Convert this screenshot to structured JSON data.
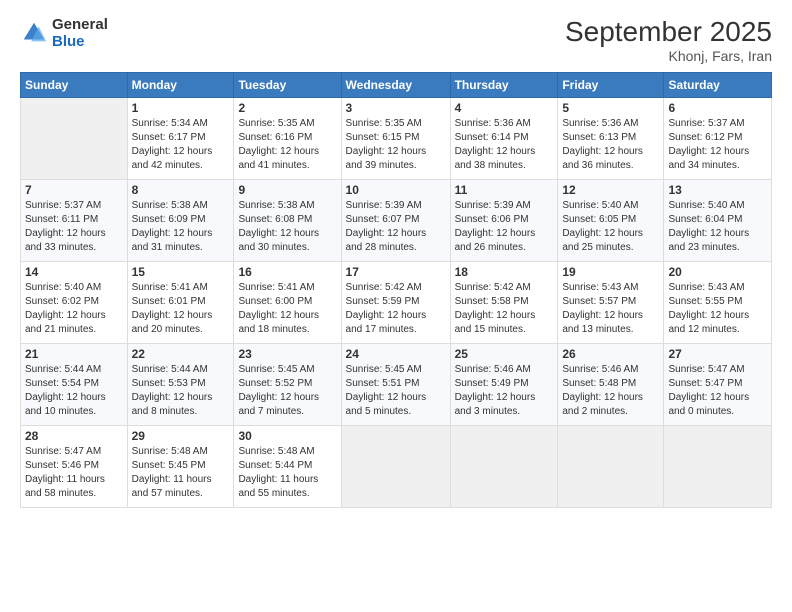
{
  "logo": {
    "general": "General",
    "blue": "Blue"
  },
  "header": {
    "month_year": "September 2025",
    "location": "Khonj, Fars, Iran"
  },
  "days_of_week": [
    "Sunday",
    "Monday",
    "Tuesday",
    "Wednesday",
    "Thursday",
    "Friday",
    "Saturday"
  ],
  "weeks": [
    [
      {
        "day": "",
        "info": ""
      },
      {
        "day": "1",
        "info": "Sunrise: 5:34 AM\nSunset: 6:17 PM\nDaylight: 12 hours\nand 42 minutes."
      },
      {
        "day": "2",
        "info": "Sunrise: 5:35 AM\nSunset: 6:16 PM\nDaylight: 12 hours\nand 41 minutes."
      },
      {
        "day": "3",
        "info": "Sunrise: 5:35 AM\nSunset: 6:15 PM\nDaylight: 12 hours\nand 39 minutes."
      },
      {
        "day": "4",
        "info": "Sunrise: 5:36 AM\nSunset: 6:14 PM\nDaylight: 12 hours\nand 38 minutes."
      },
      {
        "day": "5",
        "info": "Sunrise: 5:36 AM\nSunset: 6:13 PM\nDaylight: 12 hours\nand 36 minutes."
      },
      {
        "day": "6",
        "info": "Sunrise: 5:37 AM\nSunset: 6:12 PM\nDaylight: 12 hours\nand 34 minutes."
      }
    ],
    [
      {
        "day": "7",
        "info": "Sunrise: 5:37 AM\nSunset: 6:11 PM\nDaylight: 12 hours\nand 33 minutes."
      },
      {
        "day": "8",
        "info": "Sunrise: 5:38 AM\nSunset: 6:09 PM\nDaylight: 12 hours\nand 31 minutes."
      },
      {
        "day": "9",
        "info": "Sunrise: 5:38 AM\nSunset: 6:08 PM\nDaylight: 12 hours\nand 30 minutes."
      },
      {
        "day": "10",
        "info": "Sunrise: 5:39 AM\nSunset: 6:07 PM\nDaylight: 12 hours\nand 28 minutes."
      },
      {
        "day": "11",
        "info": "Sunrise: 5:39 AM\nSunset: 6:06 PM\nDaylight: 12 hours\nand 26 minutes."
      },
      {
        "day": "12",
        "info": "Sunrise: 5:40 AM\nSunset: 6:05 PM\nDaylight: 12 hours\nand 25 minutes."
      },
      {
        "day": "13",
        "info": "Sunrise: 5:40 AM\nSunset: 6:04 PM\nDaylight: 12 hours\nand 23 minutes."
      }
    ],
    [
      {
        "day": "14",
        "info": "Sunrise: 5:40 AM\nSunset: 6:02 PM\nDaylight: 12 hours\nand 21 minutes."
      },
      {
        "day": "15",
        "info": "Sunrise: 5:41 AM\nSunset: 6:01 PM\nDaylight: 12 hours\nand 20 minutes."
      },
      {
        "day": "16",
        "info": "Sunrise: 5:41 AM\nSunset: 6:00 PM\nDaylight: 12 hours\nand 18 minutes."
      },
      {
        "day": "17",
        "info": "Sunrise: 5:42 AM\nSunset: 5:59 PM\nDaylight: 12 hours\nand 17 minutes."
      },
      {
        "day": "18",
        "info": "Sunrise: 5:42 AM\nSunset: 5:58 PM\nDaylight: 12 hours\nand 15 minutes."
      },
      {
        "day": "19",
        "info": "Sunrise: 5:43 AM\nSunset: 5:57 PM\nDaylight: 12 hours\nand 13 minutes."
      },
      {
        "day": "20",
        "info": "Sunrise: 5:43 AM\nSunset: 5:55 PM\nDaylight: 12 hours\nand 12 minutes."
      }
    ],
    [
      {
        "day": "21",
        "info": "Sunrise: 5:44 AM\nSunset: 5:54 PM\nDaylight: 12 hours\nand 10 minutes."
      },
      {
        "day": "22",
        "info": "Sunrise: 5:44 AM\nSunset: 5:53 PM\nDaylight: 12 hours\nand 8 minutes."
      },
      {
        "day": "23",
        "info": "Sunrise: 5:45 AM\nSunset: 5:52 PM\nDaylight: 12 hours\nand 7 minutes."
      },
      {
        "day": "24",
        "info": "Sunrise: 5:45 AM\nSunset: 5:51 PM\nDaylight: 12 hours\nand 5 minutes."
      },
      {
        "day": "25",
        "info": "Sunrise: 5:46 AM\nSunset: 5:49 PM\nDaylight: 12 hours\nand 3 minutes."
      },
      {
        "day": "26",
        "info": "Sunrise: 5:46 AM\nSunset: 5:48 PM\nDaylight: 12 hours\nand 2 minutes."
      },
      {
        "day": "27",
        "info": "Sunrise: 5:47 AM\nSunset: 5:47 PM\nDaylight: 12 hours\nand 0 minutes."
      }
    ],
    [
      {
        "day": "28",
        "info": "Sunrise: 5:47 AM\nSunset: 5:46 PM\nDaylight: 11 hours\nand 58 minutes."
      },
      {
        "day": "29",
        "info": "Sunrise: 5:48 AM\nSunset: 5:45 PM\nDaylight: 11 hours\nand 57 minutes."
      },
      {
        "day": "30",
        "info": "Sunrise: 5:48 AM\nSunset: 5:44 PM\nDaylight: 11 hours\nand 55 minutes."
      },
      {
        "day": "",
        "info": ""
      },
      {
        "day": "",
        "info": ""
      },
      {
        "day": "",
        "info": ""
      },
      {
        "day": "",
        "info": ""
      }
    ]
  ]
}
